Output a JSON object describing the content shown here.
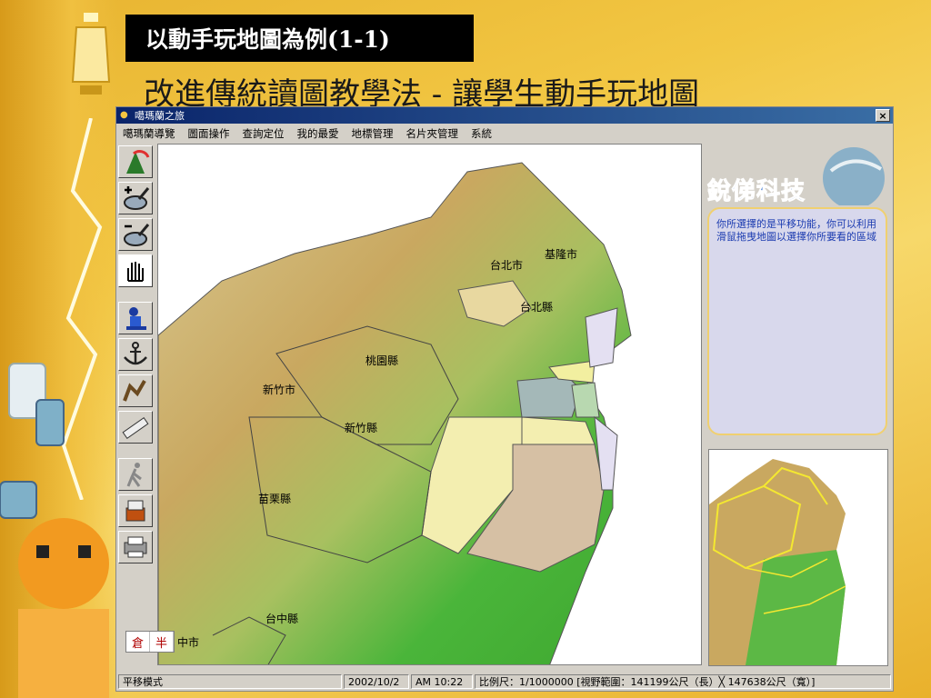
{
  "slide": {
    "title": "以動手玩地圖為例(1-1)",
    "subtitle": "改進傳統讀圖教學法 - 讓學生動手玩地圖"
  },
  "window": {
    "title": "噶瑪蘭之旅",
    "close_label": "×"
  },
  "menu": [
    "噶瑪蘭導覽",
    "圖面操作",
    "查詢定位",
    "我的最愛",
    "地標管理",
    "名片夾管理",
    "系統"
  ],
  "toolbar": [
    {
      "name": "map-view-icon"
    },
    {
      "name": "zoom-in-icon"
    },
    {
      "name": "zoom-out-icon"
    },
    {
      "name": "pan-hand-icon"
    },
    {
      "name": "landmark-icon"
    },
    {
      "name": "anchor-icon"
    },
    {
      "name": "route-icon"
    },
    {
      "name": "ruler-icon"
    },
    {
      "name": "walker-icon"
    },
    {
      "name": "card-file-icon"
    },
    {
      "name": "printer-icon"
    }
  ],
  "map": {
    "labels": [
      {
        "text": "台北市"
      },
      {
        "text": "基隆市"
      },
      {
        "text": "台北縣"
      },
      {
        "text": "桃園縣"
      },
      {
        "text": "新竹市"
      },
      {
        "text": "新竹縣"
      },
      {
        "text": "苗栗縣"
      },
      {
        "text": "台中縣"
      },
      {
        "text": "中市"
      }
    ]
  },
  "logo": {
    "text": "銳俤科技"
  },
  "info": {
    "text": "你所選擇的是平移功能，你可以利用滑鼠拖曳地圖以選擇你所要看的區域"
  },
  "ime": {
    "left": "倉",
    "right": "半"
  },
  "status": {
    "mode": "平移模式",
    "date": "2002/10/2",
    "time": "AM 10:22",
    "scale": "比例尺：1/1000000  [視野範圍：141199公尺（長）╳ 147638公尺（寬）]"
  },
  "colors": {
    "titlebar": "#0a246a",
    "info_text": "#1a3ab0",
    "slide_bg": "#f2c743"
  }
}
